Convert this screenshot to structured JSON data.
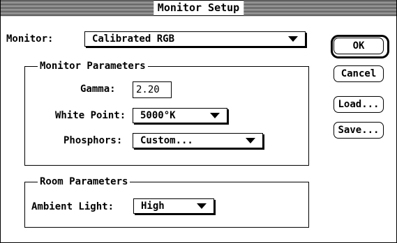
{
  "window": {
    "title": "Monitor Setup"
  },
  "monitor": {
    "label": "Monitor:",
    "value": "Calibrated RGB"
  },
  "monitor_parameters": {
    "title": "Monitor Parameters",
    "gamma": {
      "label": "Gamma:",
      "value": "2.20"
    },
    "white_point": {
      "label": "White Point:",
      "value": "5000°K"
    },
    "phosphors": {
      "label": "Phosphors:",
      "value": "Custom..."
    }
  },
  "room_parameters": {
    "title": "Room Parameters",
    "ambient_light": {
      "label": "Ambient Light:",
      "value": "High"
    }
  },
  "buttons": {
    "ok": "OK",
    "cancel": "Cancel",
    "load": "Load...",
    "save": "Save..."
  }
}
